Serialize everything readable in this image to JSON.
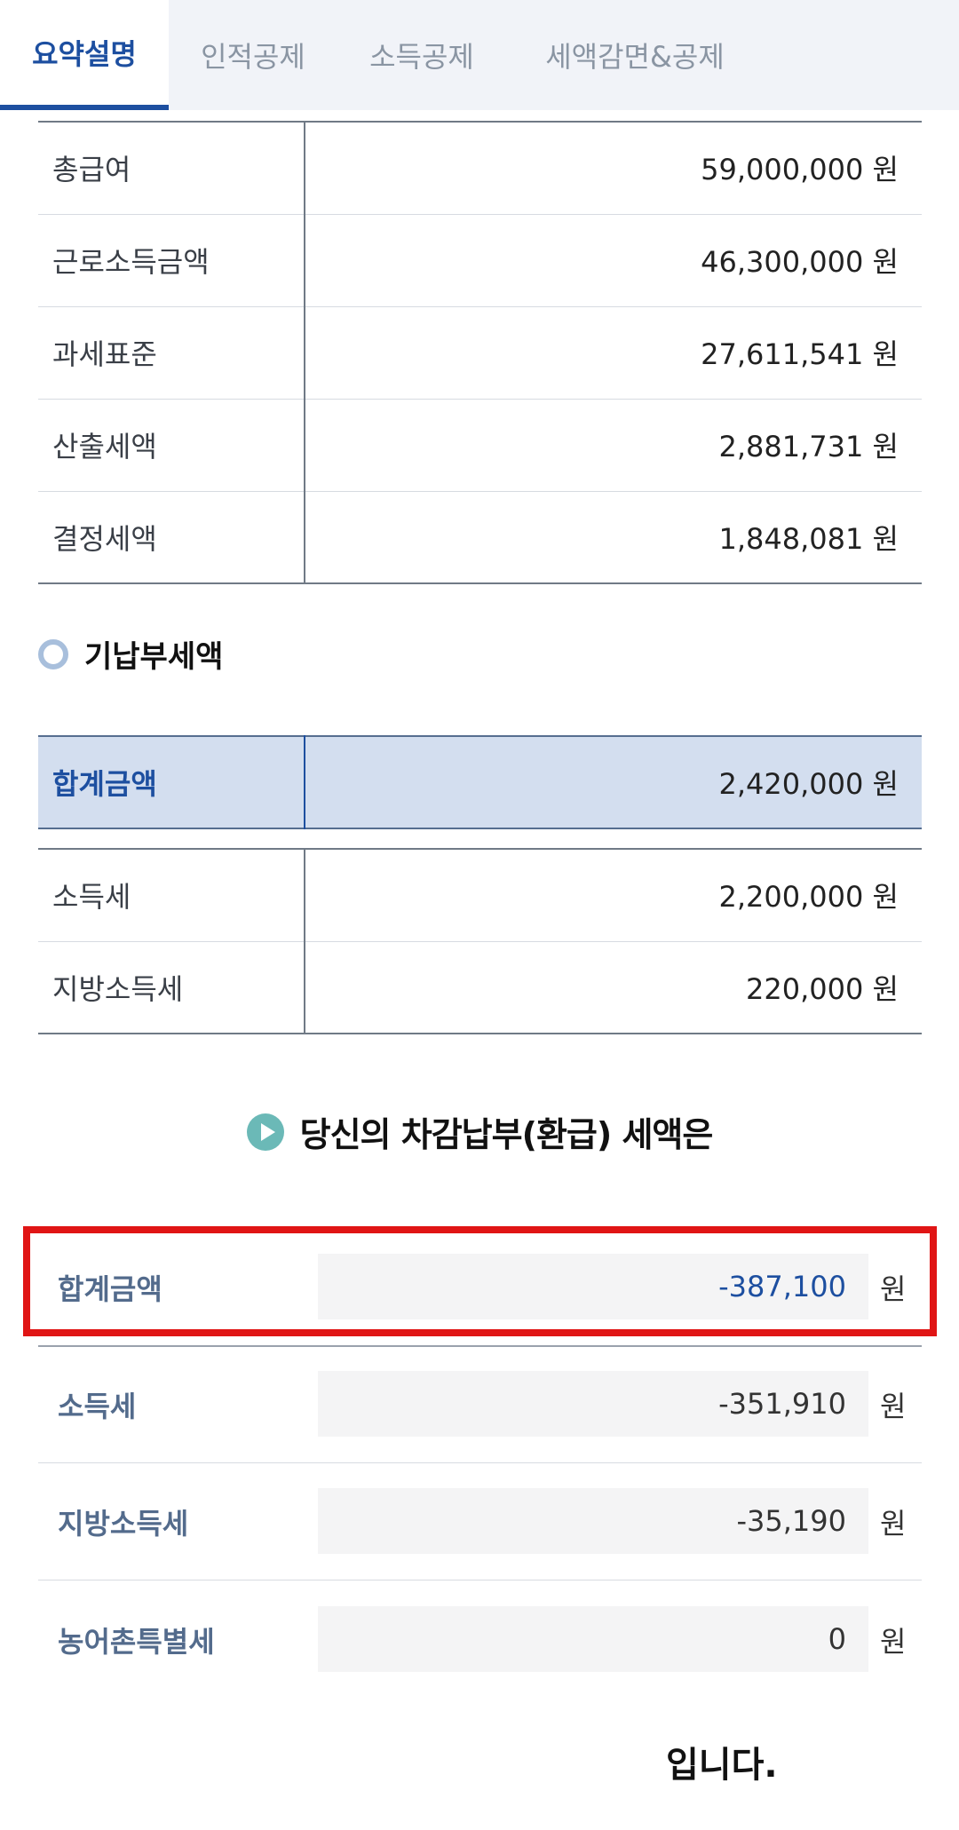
{
  "tabs": [
    {
      "label": "요약설명"
    },
    {
      "label": "인적공제"
    },
    {
      "label": "소득공제"
    },
    {
      "label": "세액감면&공제"
    }
  ],
  "summary": [
    {
      "label": "총급여",
      "value": "59,000,000 원"
    },
    {
      "label": "근로소득금액",
      "value": "46,300,000 원"
    },
    {
      "label": "과세표준",
      "value": "27,611,541 원"
    },
    {
      "label": "산출세액",
      "value": "2,881,731 원"
    },
    {
      "label": "결정세액",
      "value": "1,848,081 원"
    }
  ],
  "prepaid": {
    "title": "기납부세액",
    "total": {
      "label": "합계금액",
      "value": "2,420,000 원"
    },
    "items": [
      {
        "label": "소득세",
        "value": "2,200,000 원"
      },
      {
        "label": "지방소득세",
        "value": "220,000 원"
      }
    ]
  },
  "result": {
    "heading": "당신의 차감납부(환급) 세액은",
    "unit": "원",
    "rows": [
      {
        "label": "합계금액",
        "value": "-387,100"
      },
      {
        "label": "소득세",
        "value": "-351,910"
      },
      {
        "label": "지방소득세",
        "value": "-35,190"
      },
      {
        "label": "농어촌특별세",
        "value": "0"
      }
    ],
    "closing": "입니다."
  },
  "colors": {
    "accent": "#1d4fa0",
    "highlight": "#e01515",
    "teal": "#6bb9b7"
  }
}
